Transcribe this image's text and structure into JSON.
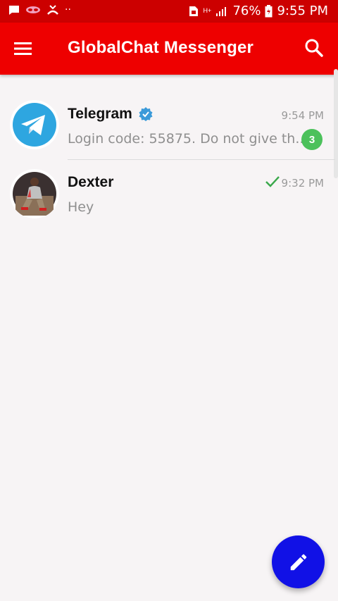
{
  "status_bar": {
    "battery_percent": "76%",
    "time": "9:55 PM",
    "network": "H+"
  },
  "app_bar": {
    "title": "GlobalChat Messenger",
    "menu_icon": "hamburger-menu-icon",
    "search_icon": "search-icon"
  },
  "chats": [
    {
      "name": "Telegram",
      "verified": true,
      "time": "9:54 PM",
      "preview": "Login code: 55875. Do not give th...",
      "unread_count": "3",
      "avatar_icon": "telegram-logo-icon"
    },
    {
      "name": "Dexter",
      "verified": false,
      "time": "9:32 PM",
      "preview": "Hey",
      "status_icon": "sent-check-icon",
      "avatar_icon": "user-photo-avatar"
    }
  ],
  "fab": {
    "icon": "pencil-icon"
  },
  "colors": {
    "status_bar": "#cc0000",
    "app_bar": "#ee0000",
    "fab": "#1111e6",
    "badge": "#4cc15b",
    "verified": "#3b9ad9",
    "telegram": "#2ea6e0",
    "check": "#3aa84b"
  }
}
